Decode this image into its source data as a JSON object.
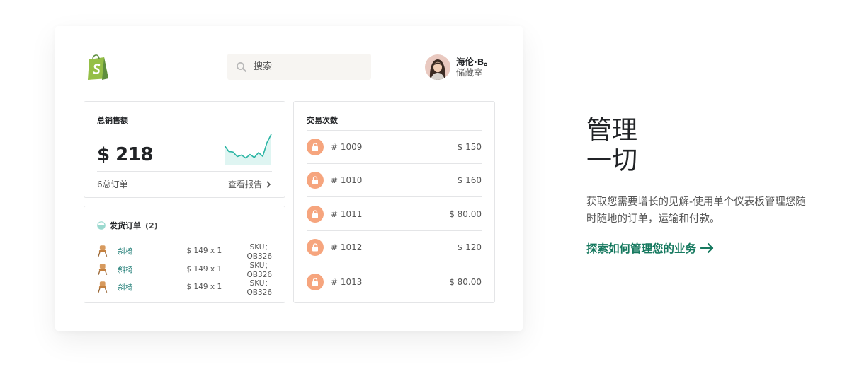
{
  "header": {
    "logo_icon": "shopify-bag-icon",
    "search": {
      "placeholder": "搜索",
      "icon": "search-icon"
    },
    "user": {
      "name": "海伦·B。",
      "store": "储藏室"
    }
  },
  "sales": {
    "title": "总销售额",
    "amount": "$ 218",
    "orders_text": "6总订单",
    "report_link": "查看报告",
    "trend": [
      0.62,
      0.42,
      0.4,
      0.25,
      0.3,
      0.2,
      0.32,
      0.22,
      0.38,
      0.26,
      0.72,
      1.0
    ]
  },
  "orders": {
    "title": "发货订单",
    "count": "(2)",
    "items": [
      {
        "name": "斜椅",
        "price": "$ 149 x 1",
        "sku": "SKU：OB326"
      },
      {
        "name": "斜椅",
        "price": "$ 149 x 1",
        "sku": "SKU：OB326"
      },
      {
        "name": "斜椅",
        "price": "$ 149 x 1",
        "sku": "SKU：OB326"
      }
    ]
  },
  "transactions": {
    "title": "交易次数",
    "rows": [
      {
        "id": "# 1009",
        "amount": "$ 150"
      },
      {
        "id": "# 1010",
        "amount": "$ 160"
      },
      {
        "id": "# 1011",
        "amount": "$ 80.00"
      },
      {
        "id": "# 1012",
        "amount": "$ 120"
      },
      {
        "id": "# 1013",
        "amount": "$ 80.00"
      }
    ]
  },
  "promo": {
    "heading_line1": "管理",
    "heading_line2": "一切",
    "description": "获取您需要增长的见解-使用单个仪表板管理您随时随地的订单，运输和付款。",
    "cta": "探索如何管理您的业务"
  },
  "colors": {
    "brand_green": "#95bf47",
    "cta_green": "#16795f",
    "teal": "#2bb5a4",
    "lock_orange": "#f6a57e"
  }
}
